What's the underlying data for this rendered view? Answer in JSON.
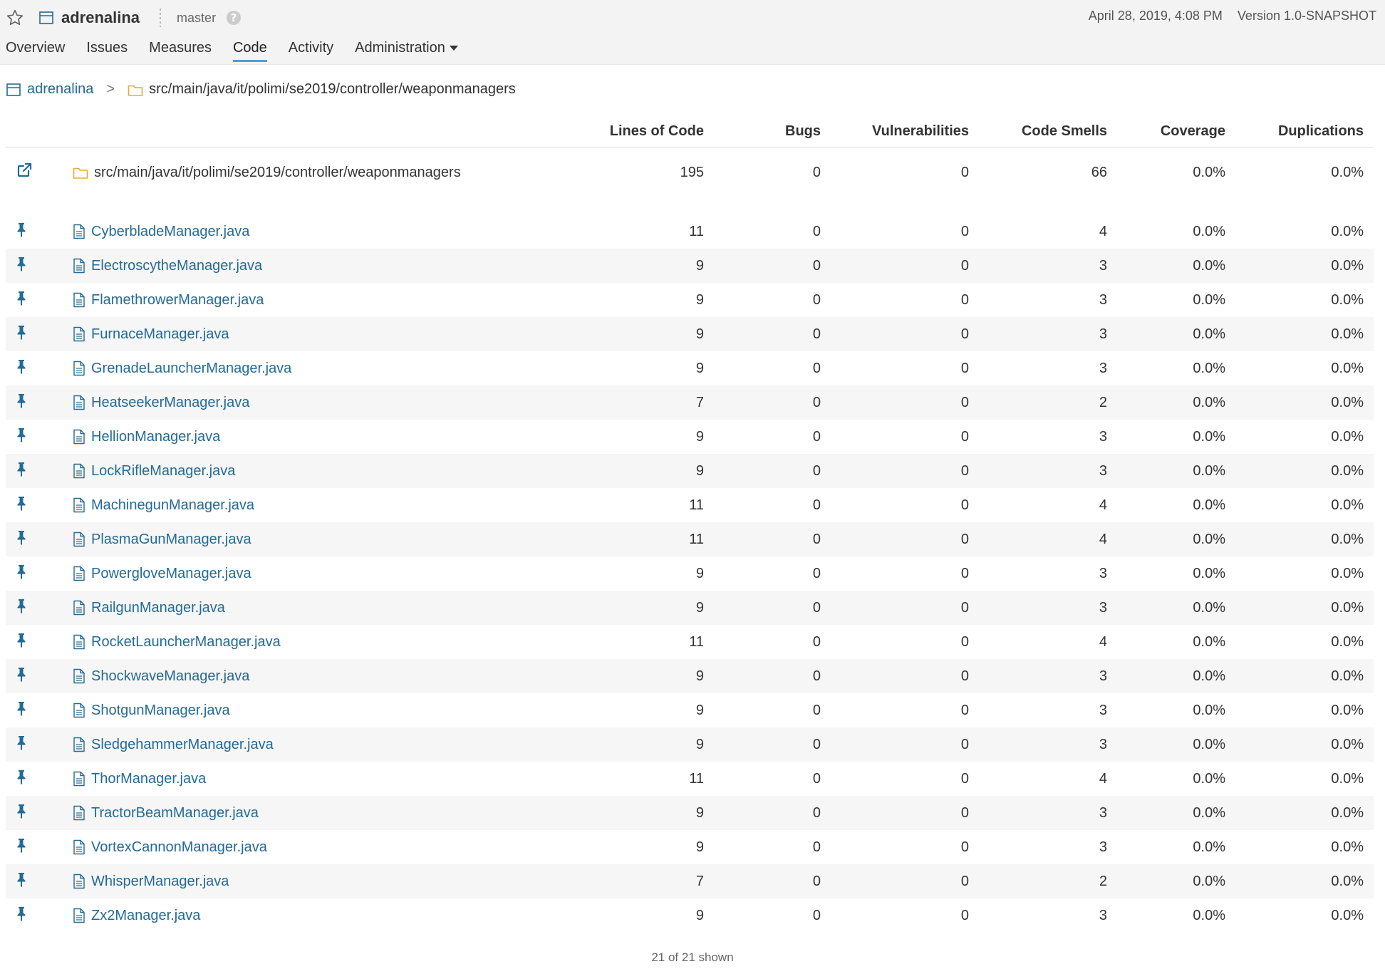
{
  "project": {
    "name": "adrenalina",
    "branch": "master"
  },
  "meta": {
    "date": "April 28, 2019, 4:08 PM",
    "version": "Version 1.0-SNAPSHOT"
  },
  "tabs": [
    {
      "label": "Overview"
    },
    {
      "label": "Issues"
    },
    {
      "label": "Measures"
    },
    {
      "label": "Code"
    },
    {
      "label": "Activity"
    },
    {
      "label": "Administration"
    }
  ],
  "breadcrumb": {
    "project": "adrenalina",
    "separator": ">",
    "path": "src/main/java/it/polimi/se2019/controller/weaponmanagers"
  },
  "columns": [
    "Lines of Code",
    "Bugs",
    "Vulnerabilities",
    "Code Smells",
    "Coverage",
    "Duplications"
  ],
  "root": {
    "name": "src/main/java/it/polimi/se2019/controller/weaponmanagers",
    "loc": "195",
    "bugs": "0",
    "vulns": "0",
    "smells": "66",
    "coverage": "0.0%",
    "dup": "0.0%"
  },
  "files": [
    {
      "name": "CyberbladeManager.java",
      "loc": "11",
      "bugs": "0",
      "vulns": "0",
      "smells": "4",
      "coverage": "0.0%",
      "dup": "0.0%"
    },
    {
      "name": "ElectroscytheManager.java",
      "loc": "9",
      "bugs": "0",
      "vulns": "0",
      "smells": "3",
      "coverage": "0.0%",
      "dup": "0.0%"
    },
    {
      "name": "FlamethrowerManager.java",
      "loc": "9",
      "bugs": "0",
      "vulns": "0",
      "smells": "3",
      "coverage": "0.0%",
      "dup": "0.0%"
    },
    {
      "name": "FurnaceManager.java",
      "loc": "9",
      "bugs": "0",
      "vulns": "0",
      "smells": "3",
      "coverage": "0.0%",
      "dup": "0.0%"
    },
    {
      "name": "GrenadeLauncherManager.java",
      "loc": "9",
      "bugs": "0",
      "vulns": "0",
      "smells": "3",
      "coverage": "0.0%",
      "dup": "0.0%"
    },
    {
      "name": "HeatseekerManager.java",
      "loc": "7",
      "bugs": "0",
      "vulns": "0",
      "smells": "2",
      "coverage": "0.0%",
      "dup": "0.0%"
    },
    {
      "name": "HellionManager.java",
      "loc": "9",
      "bugs": "0",
      "vulns": "0",
      "smells": "3",
      "coverage": "0.0%",
      "dup": "0.0%"
    },
    {
      "name": "LockRifleManager.java",
      "loc": "9",
      "bugs": "0",
      "vulns": "0",
      "smells": "3",
      "coverage": "0.0%",
      "dup": "0.0%"
    },
    {
      "name": "MachinegunManager.java",
      "loc": "11",
      "bugs": "0",
      "vulns": "0",
      "smells": "4",
      "coverage": "0.0%",
      "dup": "0.0%"
    },
    {
      "name": "PlasmaGunManager.java",
      "loc": "11",
      "bugs": "0",
      "vulns": "0",
      "smells": "4",
      "coverage": "0.0%",
      "dup": "0.0%"
    },
    {
      "name": "PowergloveManager.java",
      "loc": "9",
      "bugs": "0",
      "vulns": "0",
      "smells": "3",
      "coverage": "0.0%",
      "dup": "0.0%"
    },
    {
      "name": "RailgunManager.java",
      "loc": "9",
      "bugs": "0",
      "vulns": "0",
      "smells": "3",
      "coverage": "0.0%",
      "dup": "0.0%"
    },
    {
      "name": "RocketLauncherManager.java",
      "loc": "11",
      "bugs": "0",
      "vulns": "0",
      "smells": "4",
      "coverage": "0.0%",
      "dup": "0.0%"
    },
    {
      "name": "ShockwaveManager.java",
      "loc": "9",
      "bugs": "0",
      "vulns": "0",
      "smells": "3",
      "coverage": "0.0%",
      "dup": "0.0%"
    },
    {
      "name": "ShotgunManager.java",
      "loc": "9",
      "bugs": "0",
      "vulns": "0",
      "smells": "3",
      "coverage": "0.0%",
      "dup": "0.0%"
    },
    {
      "name": "SledgehammerManager.java",
      "loc": "9",
      "bugs": "0",
      "vulns": "0",
      "smells": "3",
      "coverage": "0.0%",
      "dup": "0.0%"
    },
    {
      "name": "ThorManager.java",
      "loc": "11",
      "bugs": "0",
      "vulns": "0",
      "smells": "4",
      "coverage": "0.0%",
      "dup": "0.0%"
    },
    {
      "name": "TractorBeamManager.java",
      "loc": "9",
      "bugs": "0",
      "vulns": "0",
      "smells": "3",
      "coverage": "0.0%",
      "dup": "0.0%"
    },
    {
      "name": "VortexCannonManager.java",
      "loc": "9",
      "bugs": "0",
      "vulns": "0",
      "smells": "3",
      "coverage": "0.0%",
      "dup": "0.0%"
    },
    {
      "name": "WhisperManager.java",
      "loc": "7",
      "bugs": "0",
      "vulns": "0",
      "smells": "2",
      "coverage": "0.0%",
      "dup": "0.0%"
    },
    {
      "name": "Zx2Manager.java",
      "loc": "9",
      "bugs": "0",
      "vulns": "0",
      "smells": "3",
      "coverage": "0.0%",
      "dup": "0.0%"
    }
  ],
  "footer": "21 of 21 shown",
  "colors": {
    "link": "#236a97",
    "accent": "#4b9fd5",
    "folder": "#f0a830",
    "stripe": "#f6f6f6"
  },
  "icons": {
    "star": "star-icon",
    "project": "project-icon",
    "branch": "branch-icon",
    "help": "help-icon",
    "open": "external-link-icon",
    "pin": "pin-icon",
    "file": "file-icon",
    "folder": "folder-icon"
  }
}
